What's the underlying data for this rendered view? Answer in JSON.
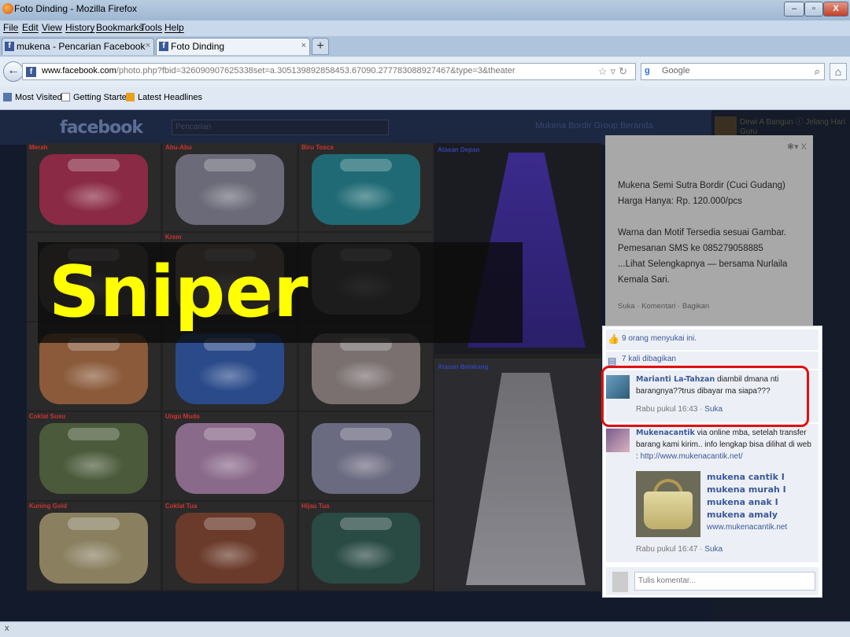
{
  "window": {
    "title": "Foto Dinding - Mozilla Firefox",
    "min": "–",
    "max": "▫",
    "close": "X"
  },
  "menu": [
    "File",
    "Edit",
    "View",
    "History",
    "Bookmarks",
    "Tools",
    "Help"
  ],
  "tabs": [
    {
      "label": "mukena - Pencarian Facebook"
    },
    {
      "label": "Foto Dinding"
    }
  ],
  "nav": {
    "url_domain": "www.facebook.com",
    "url_rest": "/photo.php?fbid=326090907625338set=a.305139892858453.67090.277783088927467&type=3&theater",
    "search_placeholder": "Google"
  },
  "bookmarks": [
    "Most Visited",
    "Getting Started",
    "Latest Headlines"
  ],
  "fb": {
    "logo": "facebook",
    "search_placeholder": "Pencarian",
    "user": "Mukena Bordir Group",
    "home": "Beranda",
    "ticker_text": "Dewi A Bangun ⓘ Jelang Hari Guru"
  },
  "photo": {
    "captions": [
      "Merah",
      "Abu-Abu",
      "Biru Tosca",
      "",
      "Krem",
      "",
      "",
      "",
      "",
      "Coklat Susu",
      "Ungu Muda",
      "",
      "Kuning Gold",
      "Coklat Tua",
      "Hijau Tua"
    ],
    "front_label": "Atasan Depan",
    "back_label": "Atasan Belakang"
  },
  "caption_panel": {
    "line1": "Mukena Semi Sutra Bordir (Cuci Gudang)",
    "line2": "Harga Hanya: Rp. 120.000/pcs",
    "line3": "Warna dan Motif Tersedia sesuai Gambar.",
    "line4": "Pemesanan SMS ke 085279058885",
    "line5": "...Lihat Selengkapnya   — bersama Nurlaila",
    "line6": "Kemala Sari.",
    "actions": "Suka · Komentari · Bagikan"
  },
  "comments": {
    "likes": "9 orang menyukai ini.",
    "shares": "7 kali dibagikan",
    "c1": {
      "author": "Marianti La-Tahzan",
      "text": " diambil dmana nti barangnya??trus dibayar ma siapa???",
      "time": "Rabu pukul 16:43 · ",
      "like": "Suka"
    },
    "c2": {
      "author": "Mukenacantik",
      "text": " via online mba, setelah transfer barang kami kirim.. info lengkap bisa dilihat di web : ",
      "link": "http://www.mukenacantik.net/",
      "attach_lines": [
        "mukena cantik I",
        "mukena murah I",
        "mukena anak I",
        "mukena amaly"
      ],
      "attach_url": "www.mukenacantik.net",
      "time": "Rabu pukul 16:47 · ",
      "like": "Suka"
    },
    "write_placeholder": "Tulis komentar..."
  },
  "overlay": {
    "text": "Sniper",
    "color": "#ffff00"
  },
  "status": {
    "text": "x"
  }
}
